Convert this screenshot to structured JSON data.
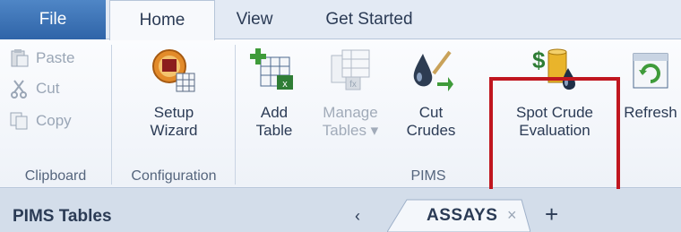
{
  "tabs": {
    "file": "File",
    "home": "Home",
    "view": "View",
    "get_started": "Get Started"
  },
  "clipboard": {
    "paste": "Paste",
    "cut": "Cut",
    "copy": "Copy",
    "group_label": "Clipboard"
  },
  "configuration": {
    "setup_wizard_line1": "Setup",
    "setup_wizard_line2": "Wizard",
    "group_label": "Configuration"
  },
  "pims": {
    "add_table_line1": "Add",
    "add_table_line2": "Table",
    "manage_tables_line1": "Manage",
    "manage_tables_line2": "Tables ▾",
    "cut_crudes_line1": "Cut",
    "cut_crudes_line2": "Crudes",
    "spot_crude_line1": "Spot Crude",
    "spot_crude_line2": "Evaluation",
    "refresh": "Refresh",
    "group_label": "PIMS"
  },
  "bottom": {
    "panel_title": "PIMS Tables",
    "nav_left": "‹",
    "doc_tab": "ASSAYS",
    "doc_tab_close": "×",
    "add_tab": "+"
  },
  "colors": {
    "file_tab": "#2f64a8",
    "highlight": "#c0161f"
  }
}
